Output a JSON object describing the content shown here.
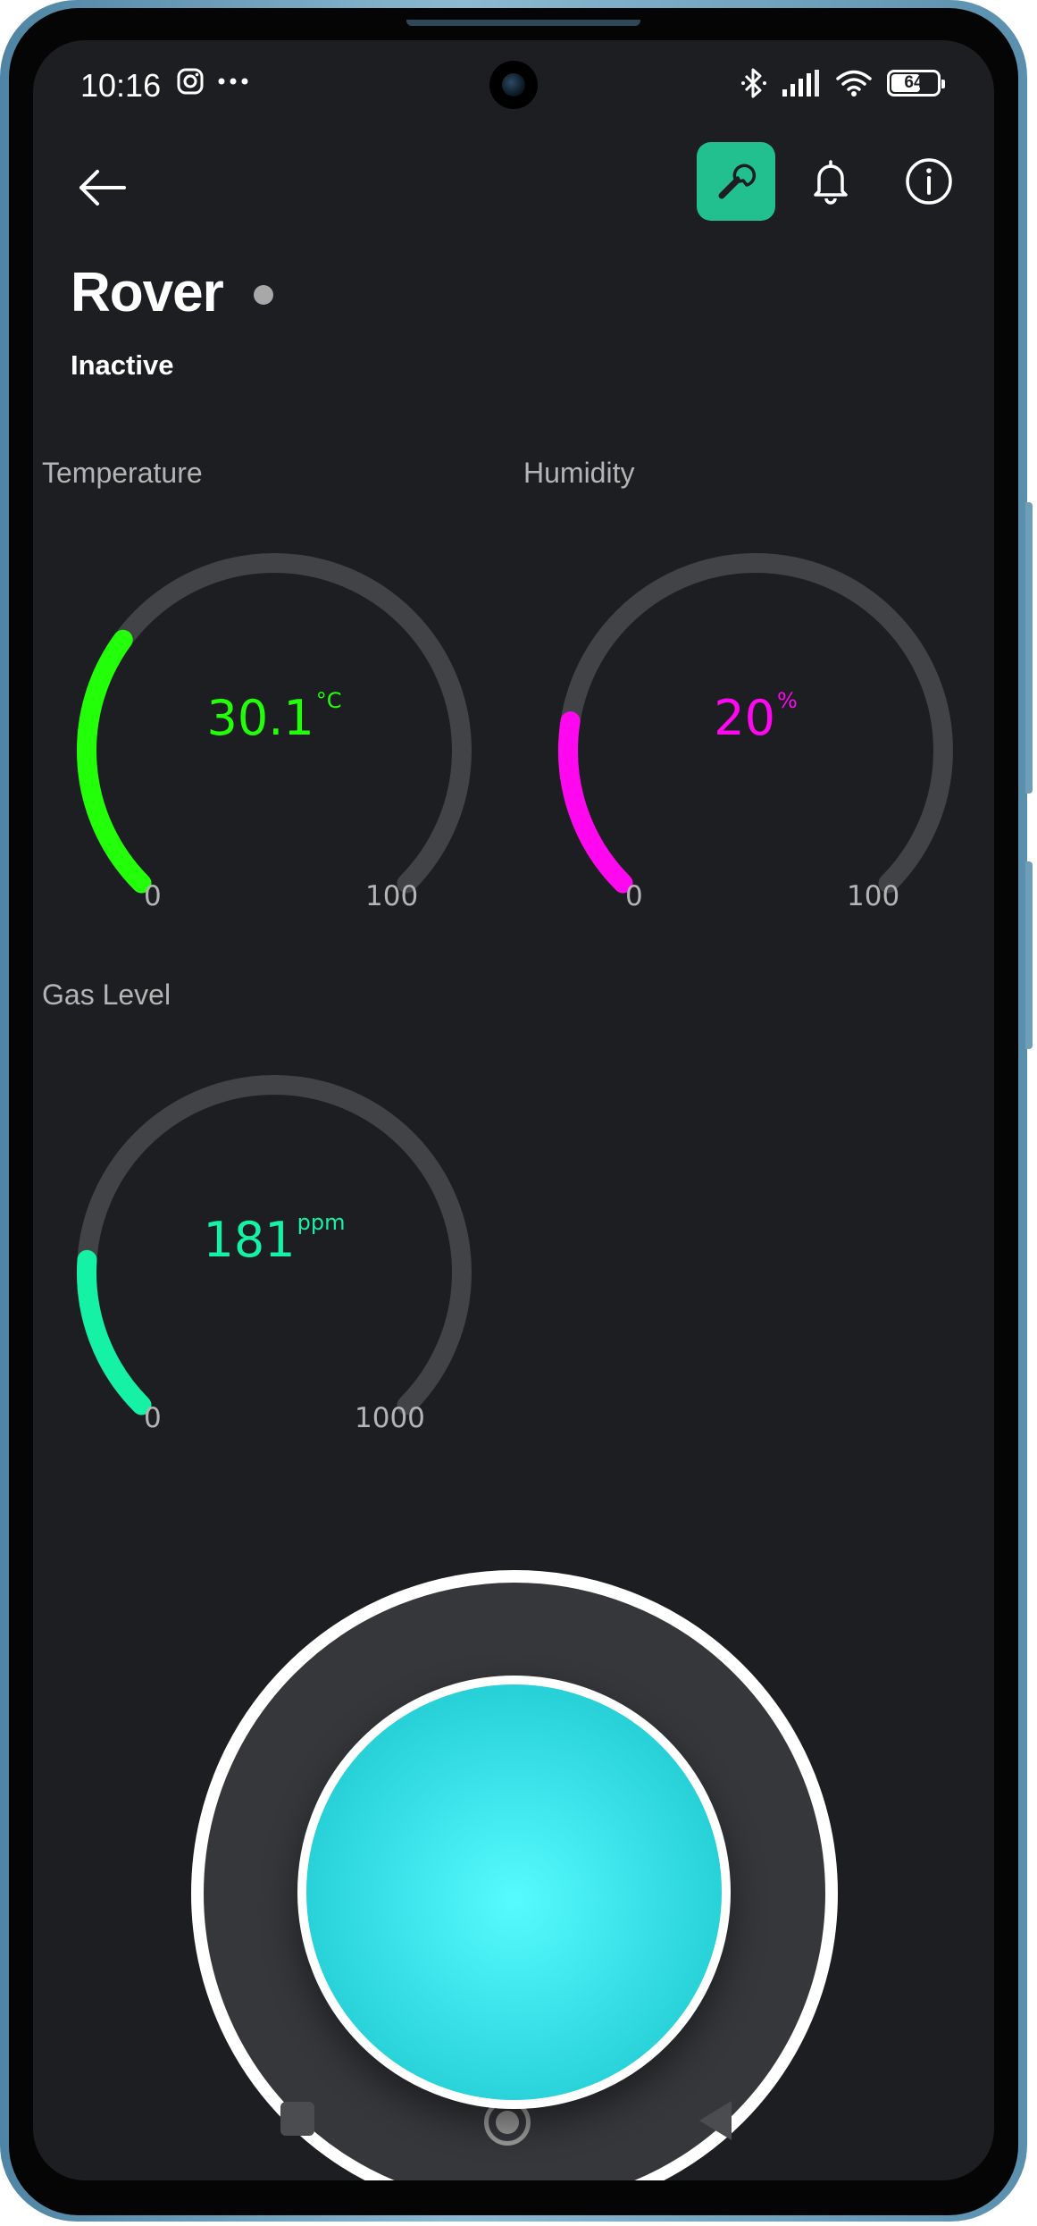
{
  "status_bar": {
    "time": "10:16",
    "battery": "64",
    "icons_left": [
      "instagram-icon",
      "more-dots-icon"
    ],
    "icons_right": [
      "bluetooth-icon",
      "signal-icon",
      "wifi-icon",
      "battery-icon"
    ]
  },
  "toolbar": {
    "back_icon": "arrow-left-icon",
    "settings_icon": "wrench-icon",
    "notifications_icon": "bell-icon",
    "info_icon": "info-icon",
    "accent_color": "#22c08f"
  },
  "device": {
    "title": "Rover",
    "status": "Inactive",
    "status_dot_color": "#a8a8a8"
  },
  "gauges": [
    {
      "label": "Temperature",
      "value": "30.1",
      "unit": "°C",
      "min": "0",
      "max": "100",
      "numeric_value": 30.1,
      "range": [
        0,
        100
      ],
      "color": "#22ff09"
    },
    {
      "label": "Humidity",
      "value": "20",
      "unit": "%",
      "min": "0",
      "max": "100",
      "numeric_value": 20,
      "range": [
        0,
        100
      ],
      "color": "#ff08f0"
    },
    {
      "label": "Gas Level",
      "value": "181",
      "unit": "ppm",
      "min": "0",
      "max": "1000",
      "numeric_value": 181,
      "range": [
        0,
        1000
      ],
      "color": "#15f2a5"
    }
  ],
  "joystick": {
    "knob_color": "#3fe6ec",
    "base_color": "#36373b"
  },
  "nav_bar": {
    "icons": [
      "recents-icon",
      "home-icon",
      "back-triangle-icon"
    ]
  }
}
